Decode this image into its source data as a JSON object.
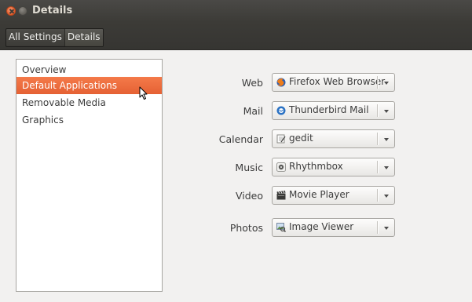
{
  "window": {
    "title": "Details"
  },
  "breadcrumb": {
    "items": [
      {
        "label": "All Settings"
      },
      {
        "label": "Details"
      }
    ]
  },
  "sidebar": {
    "items": [
      {
        "label": "Overview",
        "selected": false
      },
      {
        "label": "Default Applications",
        "selected": true
      },
      {
        "label": "Removable Media",
        "selected": false
      },
      {
        "label": "Graphics",
        "selected": false
      }
    ]
  },
  "defaults": {
    "rows": [
      {
        "label": "Web",
        "value": "Firefox Web Browser",
        "icon": "firefox-icon"
      },
      {
        "label": "Mail",
        "value": "Thunderbird Mail",
        "icon": "thunderbird-icon"
      },
      {
        "label": "Calendar",
        "value": "gedit",
        "icon": "gedit-icon"
      },
      {
        "label": "Music",
        "value": "Rhythmbox",
        "icon": "rhythmbox-icon"
      },
      {
        "label": "Video",
        "value": "Movie Player",
        "icon": "movie-player-icon"
      },
      {
        "label": "Photos",
        "value": "Image Viewer",
        "icon": "image-viewer-icon"
      }
    ]
  },
  "colors": {
    "selection": "#e9683b",
    "titlebar": "#3c3b37",
    "background": "#f2f1f0"
  }
}
